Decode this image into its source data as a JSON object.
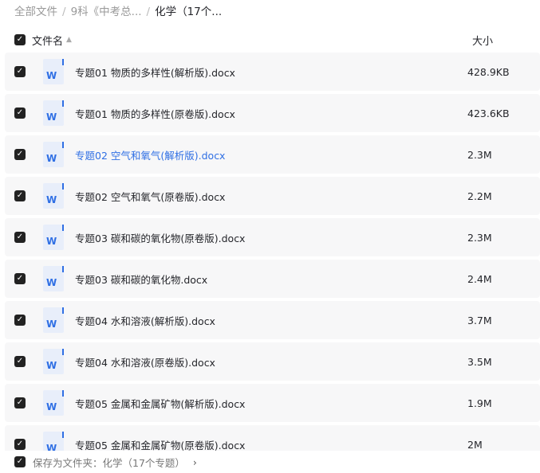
{
  "breadcrumb": [
    "全部文件",
    "9科《中考总...",
    "化学（17个..."
  ],
  "header": {
    "name": "文件名",
    "size": "大小",
    "sort_icon": "sort-icon"
  },
  "files": [
    {
      "name": "专题01 物质的多样性(解析版).docx",
      "size": "428.9KB"
    },
    {
      "name": "专题01 物质的多样性(原卷版).docx",
      "size": "423.6KB"
    },
    {
      "name": "专题02 空气和氧气(解析版).docx",
      "size": "2.3M",
      "highlight": true
    },
    {
      "name": "专题02 空气和氧气(原卷版).docx",
      "size": "2.2M"
    },
    {
      "name": "专题03 碳和碳的氧化物(原卷版).docx",
      "size": "2.3M"
    },
    {
      "name": "专题03 碳和碳的氧化物.docx",
      "size": "2.4M"
    },
    {
      "name": "专题04 水和溶液(解析版).docx",
      "size": "3.7M"
    },
    {
      "name": "专题04 水和溶液(原卷版).docx",
      "size": "3.5M"
    },
    {
      "name": "专题05 金属和金属矿物(解析版).docx",
      "size": "1.9M"
    },
    {
      "name": "专题05 金属和金属矿物(原卷版).docx",
      "size": "2M"
    }
  ],
  "footer": {
    "label": "保存为文件夹：化学（17个专题）",
    "arrow": "›"
  },
  "colors": {
    "accent": "#2f6fe4"
  }
}
